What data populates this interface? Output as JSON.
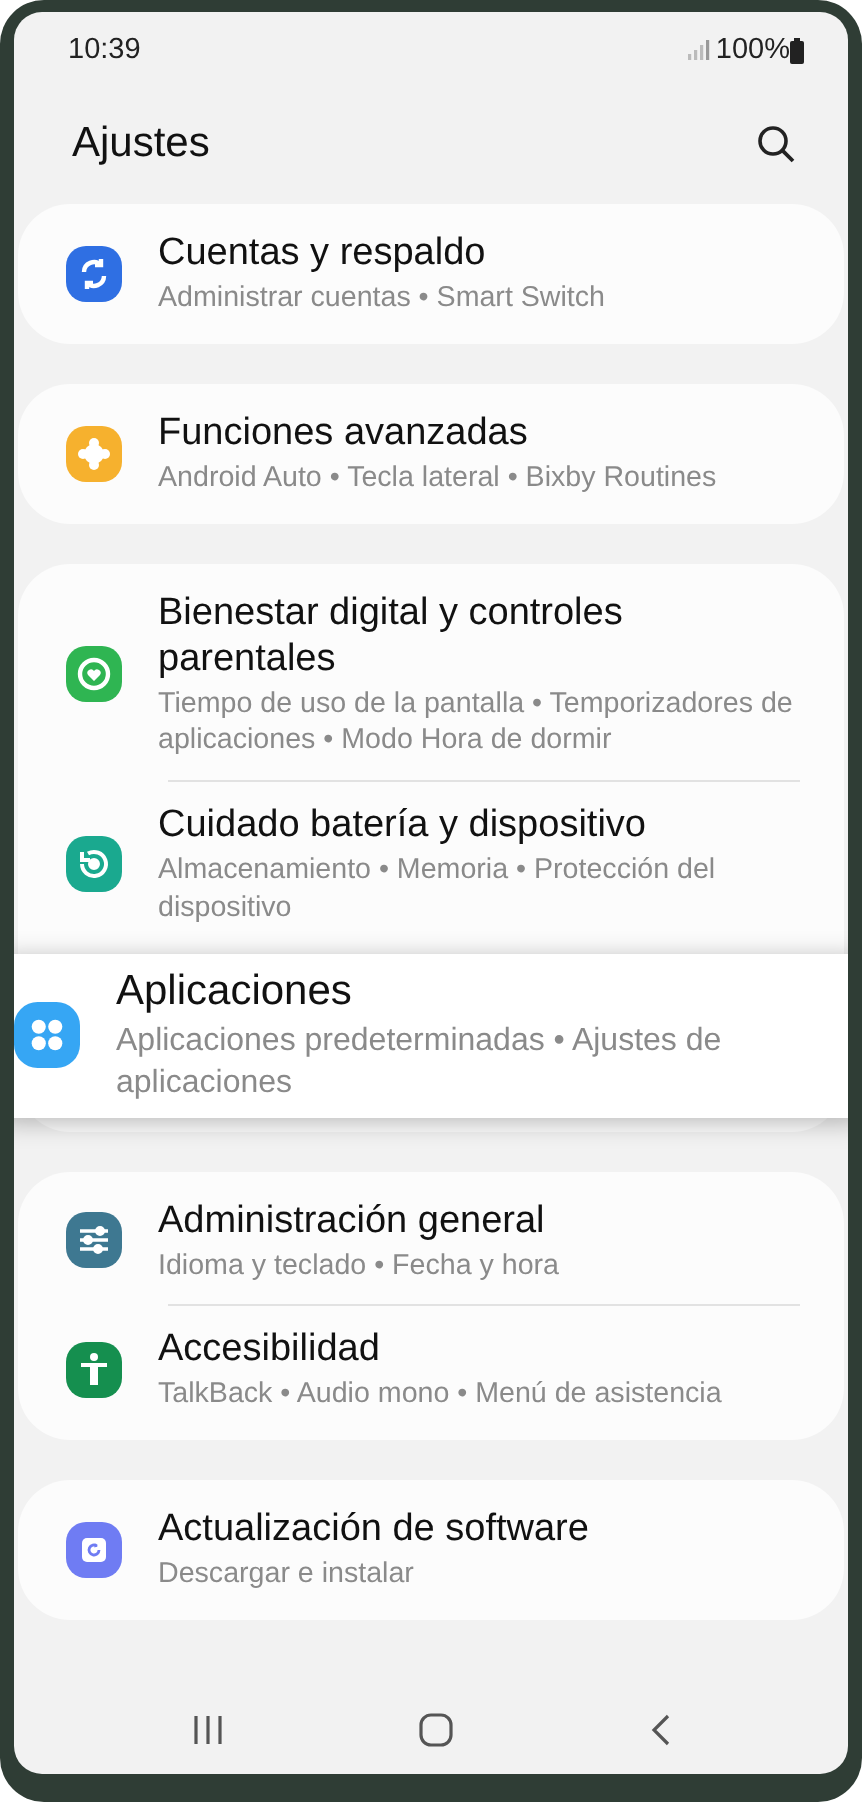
{
  "status_bar": {
    "time": "10:39",
    "battery": "100%"
  },
  "header": {
    "title": "Ajustes"
  },
  "groups": [
    {
      "items": [
        {
          "kind": "sync",
          "title": "Cuentas y respaldo",
          "subtitle": "Administrar cuentas • Smart Switch",
          "selected": false
        }
      ]
    },
    {
      "items": [
        {
          "kind": "gear",
          "title": "Funciones avanzadas",
          "subtitle": "Android Auto • Tecla lateral • Bixby Routines",
          "selected": false
        }
      ]
    },
    {
      "items": [
        {
          "kind": "wellbeing",
          "title": "Bienestar digital y controles parentales",
          "subtitle": "Tiempo de uso de la pantalla • Temporizadores de aplicaciones • Modo Hora de dormir",
          "selected": false
        },
        {
          "kind": "care",
          "title": "Cuidado batería y dispositivo",
          "subtitle": "Almacenamiento • Memoria • Protección del dispositivo",
          "selected": false
        },
        {
          "kind": "apps",
          "title": "Aplicaciones",
          "subtitle": "Aplicaciones predeterminadas • Ajustes de aplicaciones",
          "selected": true
        }
      ]
    },
    {
      "items": [
        {
          "kind": "sliders",
          "title": "Administración general",
          "subtitle": "Idioma y teclado • Fecha y hora",
          "selected": false
        },
        {
          "kind": "accessibility",
          "title": "Accesibilidad",
          "subtitle": "TalkBack • Audio mono • Menú de asistencia",
          "selected": false
        }
      ]
    },
    {
      "items": [
        {
          "kind": "update",
          "title": "Actualización de software",
          "subtitle": "Descargar e instalar",
          "selected": false
        }
      ]
    }
  ]
}
